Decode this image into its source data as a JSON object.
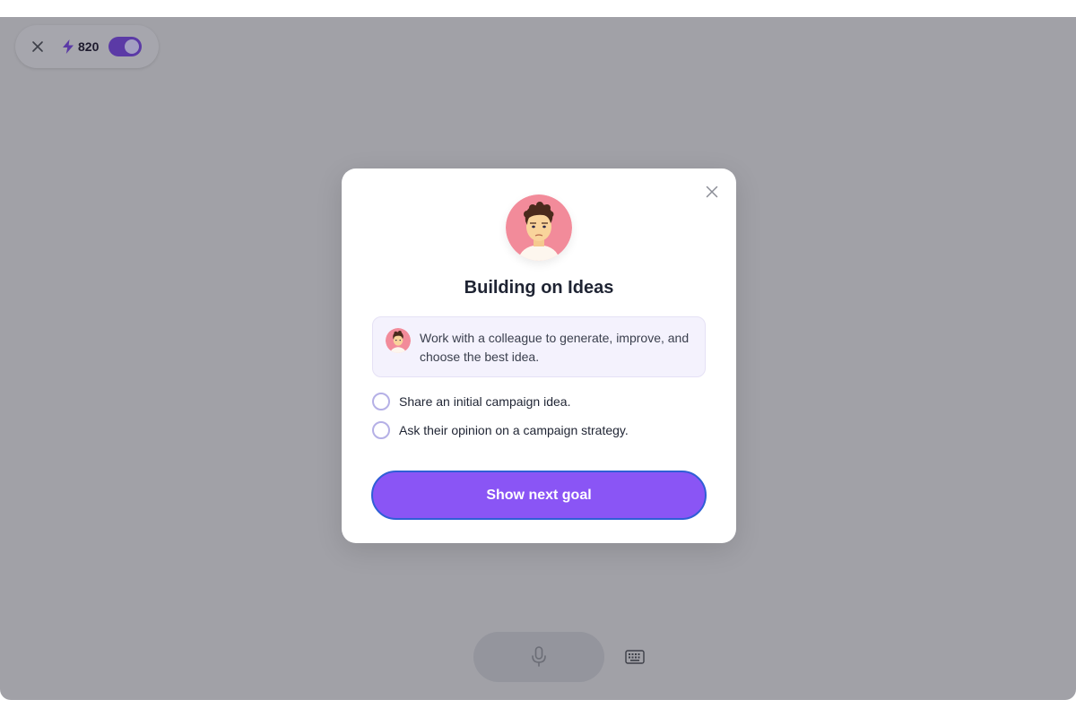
{
  "header": {
    "points": "820",
    "toggle_on": true
  },
  "modal": {
    "title": "Building on Ideas",
    "info_text": "Work with a colleague to generate, improve, and choose the best idea.",
    "goals": [
      {
        "label": "Share an initial campaign idea.",
        "checked": false
      },
      {
        "label": "Ask their opinion on a campaign strategy.",
        "checked": false
      }
    ],
    "primary_button": "Show next goal"
  },
  "icons": {
    "close": "close-icon",
    "bolt": "lightning-bolt-icon",
    "mic": "microphone-icon",
    "keyboard": "keyboard-icon"
  },
  "colors": {
    "accent": "#8a55f5",
    "toggle": "#5b3aa6",
    "overlay": "#a1a1a7",
    "button_border": "#2f5fd6"
  }
}
